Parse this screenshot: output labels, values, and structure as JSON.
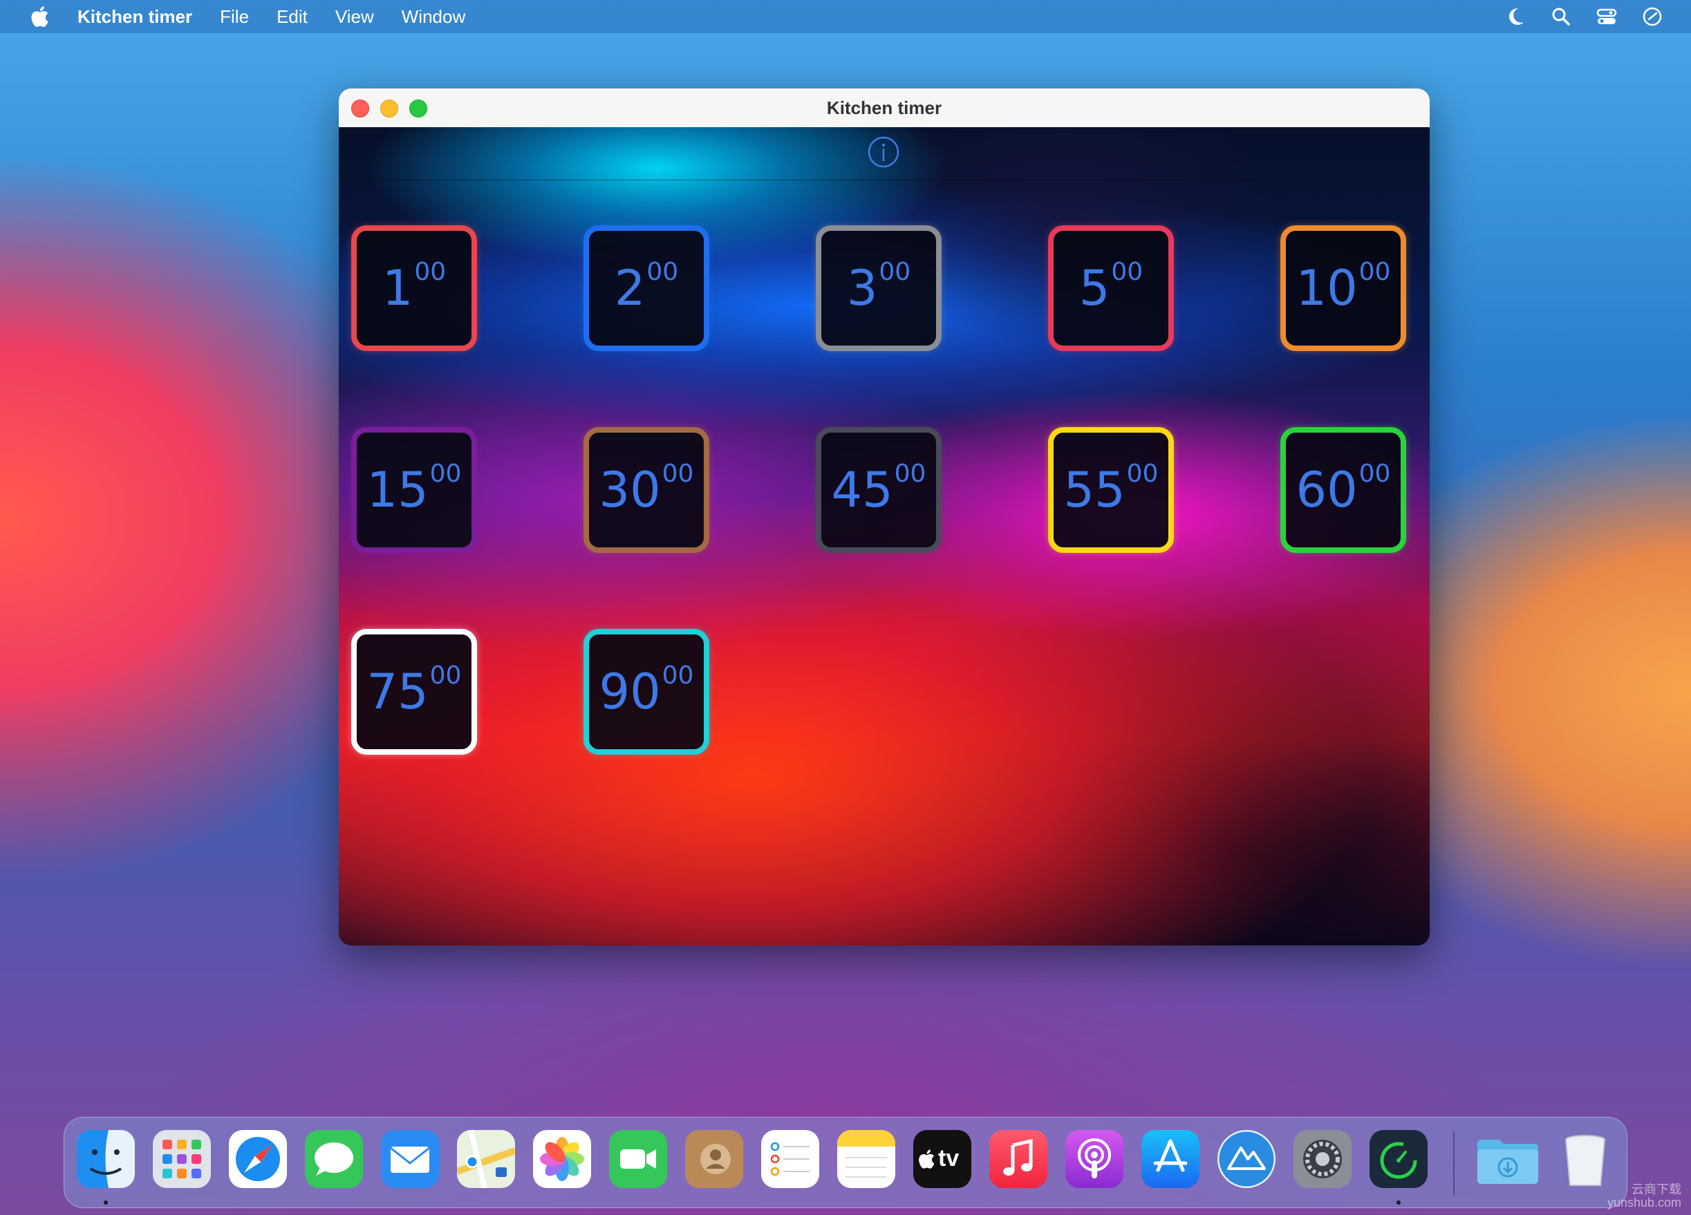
{
  "menubar": {
    "app_name": "Kitchen timer",
    "items": [
      "File",
      "Edit",
      "View",
      "Window"
    ],
    "right_icons": [
      "moon-icon",
      "search-icon",
      "control-center-icon",
      "clock-icon"
    ]
  },
  "window": {
    "title": "Kitchen timer",
    "info_icon": "info-icon"
  },
  "timers": [
    {
      "minutes": "1",
      "seconds": "00",
      "border": "#e8474d"
    },
    {
      "minutes": "2",
      "seconds": "00",
      "border": "#1f6ef0"
    },
    {
      "minutes": "3",
      "seconds": "00",
      "border": "#8a8e96"
    },
    {
      "minutes": "5",
      "seconds": "00",
      "border": "#e83a5a"
    },
    {
      "minutes": "10",
      "seconds": "00",
      "border": "#f08a2a"
    },
    {
      "minutes": "15",
      "seconds": "00",
      "border": "#7a1e9a"
    },
    {
      "minutes": "30",
      "seconds": "00",
      "border": "#a46a44"
    },
    {
      "minutes": "45",
      "seconds": "00",
      "border": "#4a4a5a"
    },
    {
      "minutes": "55",
      "seconds": "00",
      "border": "#ffd814"
    },
    {
      "minutes": "60",
      "seconds": "00",
      "border": "#28d43a"
    },
    {
      "minutes": "75",
      "seconds": "00",
      "border": "#ffffff"
    },
    {
      "minutes": "90",
      "seconds": "00",
      "border": "#22d0d8"
    }
  ],
  "dock": {
    "apps": [
      "finder-icon",
      "launchpad-icon",
      "safari-icon",
      "messages-icon",
      "mail-icon",
      "maps-icon",
      "photos-icon",
      "facetime-icon",
      "contacts-icon",
      "reminders-icon",
      "notes-icon",
      "apple-tv-icon",
      "music-icon",
      "podcasts-icon",
      "app-store-icon",
      "instruments-icon",
      "system-preferences-icon",
      "kitchen-timer-icon",
      "downloads-folder-icon",
      "trash-icon"
    ],
    "tv_label": "tv"
  },
  "watermark": [
    "云商下载",
    "yunshub.com"
  ]
}
